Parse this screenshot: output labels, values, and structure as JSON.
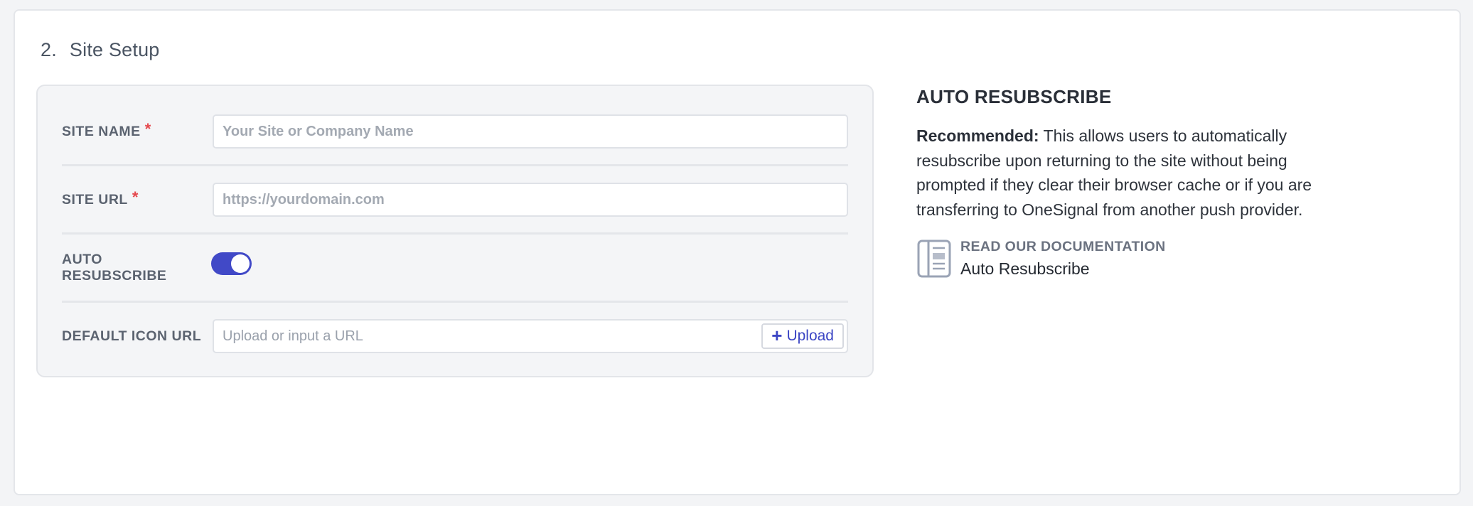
{
  "section": {
    "number": "2.",
    "title": "Site Setup"
  },
  "form": {
    "site_name": {
      "label": "SITE NAME",
      "required_mark": "*",
      "placeholder": "Your Site or Company Name"
    },
    "site_url": {
      "label": "SITE URL",
      "required_mark": "*",
      "placeholder": "https://yourdomain.com"
    },
    "auto_resubscribe": {
      "label": "AUTO RESUBSCRIBE",
      "enabled": true
    },
    "default_icon_url": {
      "label": "DEFAULT ICON URL",
      "placeholder": "Upload or input a URL",
      "upload_label": "Upload",
      "upload_icon": "plus-icon"
    }
  },
  "side": {
    "title": "AUTO RESUBSCRIBE",
    "desc_strong": "Recommended:",
    "desc_text": " This allows users to automatically resubscribe upon returning to the site without being prompted if they clear their browser cache or if you are transferring to OneSignal from another push provider.",
    "doc_kicker": "READ OUR DOCUMENTATION",
    "doc_link": "Auto Resubscribe",
    "doc_icon": "document-icon"
  },
  "colors": {
    "accent": "#4149c7",
    "required": "#e5484d",
    "panel": "#f4f5f7"
  }
}
